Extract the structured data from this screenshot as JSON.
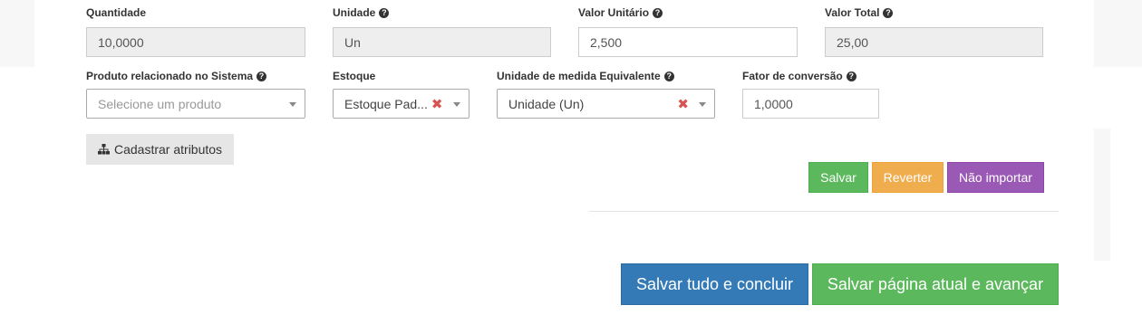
{
  "row1": {
    "quantidade": {
      "label": "Quantidade",
      "value": "10,0000"
    },
    "unidade": {
      "label": "Unidade",
      "value": "Un"
    },
    "valor_unitario": {
      "label": "Valor Unitário",
      "value": "2,500"
    },
    "valor_total": {
      "label": "Valor Total",
      "value": "25,00"
    }
  },
  "row2": {
    "produto": {
      "label": "Produto relacionado no Sistema",
      "placeholder": "Selecione um produto"
    },
    "estoque": {
      "label": "Estoque",
      "value": "Estoque Pad..."
    },
    "unidade_equiv": {
      "label": "Unidade de medida Equivalente",
      "value": "Unidade (Un)"
    },
    "fator": {
      "label": "Fator de conversão",
      "value": "1,0000"
    }
  },
  "help_glyph": "?",
  "clear_glyph": "✖",
  "icons": {
    "attributes": "sitemap-icon",
    "help": "question-circle-icon",
    "clear": "times-icon",
    "dropdown": "caret-down-icon"
  },
  "buttons": {
    "cadastrar_atributos": "Cadastrar atributos",
    "salvar": "Salvar",
    "reverter": "Reverter",
    "nao_importar": "Não importar",
    "salvar_tudo": "Salvar tudo e concluir",
    "salvar_pagina": "Salvar página atual e avançar"
  },
  "colors": {
    "success": "#5cb85c",
    "warning": "#f0ad4e",
    "purple": "#9b59b6",
    "primary": "#337ab7",
    "danger": "#d9534f"
  }
}
